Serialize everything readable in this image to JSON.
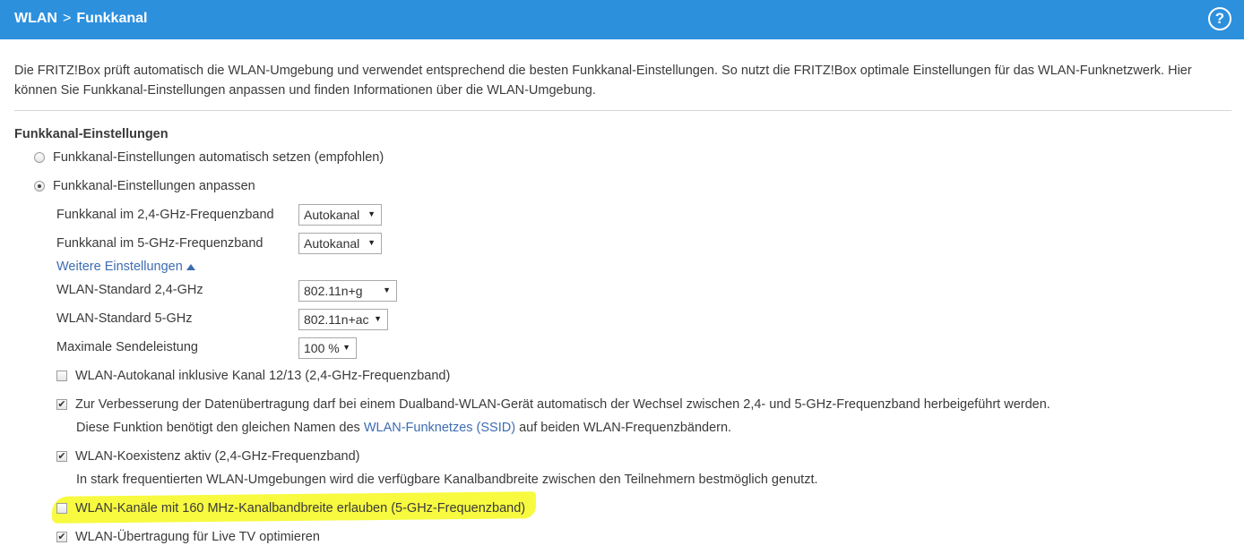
{
  "header": {
    "breadcrumb_root": "WLAN",
    "breadcrumb_separator": ">",
    "breadcrumb_current": "Funkkanal",
    "help_glyph": "?"
  },
  "intro": "Die FRITZ!Box prüft automatisch die WLAN-Umgebung und verwendet entsprechend die besten Funkkanal-Einstellungen. So nutzt die FRITZ!Box optimale Einstellungen für das WLAN-Funknetzwerk. Hier können Sie Funkkanal-Einstellungen anpassen und finden Informationen über die WLAN-Umgebung.",
  "section_title": "Funkkanal-Einstellungen",
  "radios": {
    "auto": {
      "label": "Funkkanal-Einstellungen automatisch setzen (empfohlen)",
      "checked": false
    },
    "custom": {
      "label": "Funkkanal-Einstellungen anpassen",
      "checked": true
    }
  },
  "fields": {
    "channel24": {
      "label": "Funkkanal im 2,4-GHz-Frequenzband",
      "value": "Autokanal"
    },
    "channel5": {
      "label": "Funkkanal im 5-GHz-Frequenzband",
      "value": "Autokanal"
    },
    "more_settings": "Weitere Einstellungen",
    "standard24": {
      "label": "WLAN-Standard 2,4-GHz",
      "value": "802.11n+g"
    },
    "standard5": {
      "label": "WLAN-Standard 5-GHz",
      "value": "802.11n+ac"
    },
    "power": {
      "label": "Maximale Sendeleistung",
      "value": "100 %"
    }
  },
  "checkboxes": {
    "autokanal1213": {
      "label": "WLAN-Autokanal inklusive Kanal 12/13 (2,4-GHz-Frequenzband)",
      "checked": false
    },
    "bandsteering": {
      "label": "Zur Verbesserung der Datenübertragung darf bei einem Dualband-WLAN-Gerät automatisch der Wechsel zwischen 2,4- und 5-GHz-Frequenzband herbeigeführt werden.",
      "note_before": "Diese Funktion benötigt den gleichen Namen des",
      "note_link": "WLAN-Funknetzes (SSID)",
      "note_after": "auf beiden WLAN-Frequenzbändern.",
      "checked": true
    },
    "coexistence": {
      "label": "WLAN-Koexistenz aktiv (2,4-GHz-Frequenzband)",
      "note": "In stark frequentierten WLAN-Umgebungen wird die verfügbare Kanalbandbreite zwischen den Teilnehmern bestmöglich genutzt.",
      "checked": true
    },
    "mhz160": {
      "label": "WLAN-Kanäle mit 160 MHz-Kanalbandbreite erlauben (5-GHz-Frequenzband)",
      "checked": false
    },
    "livetv": {
      "label": "WLAN-Übertragung für Live TV optimieren",
      "checked": true
    }
  },
  "check_glyph": "✔",
  "colors": {
    "header": "#2d90dd",
    "link": "#3d6cb3",
    "highlight": "#f6f92a"
  }
}
